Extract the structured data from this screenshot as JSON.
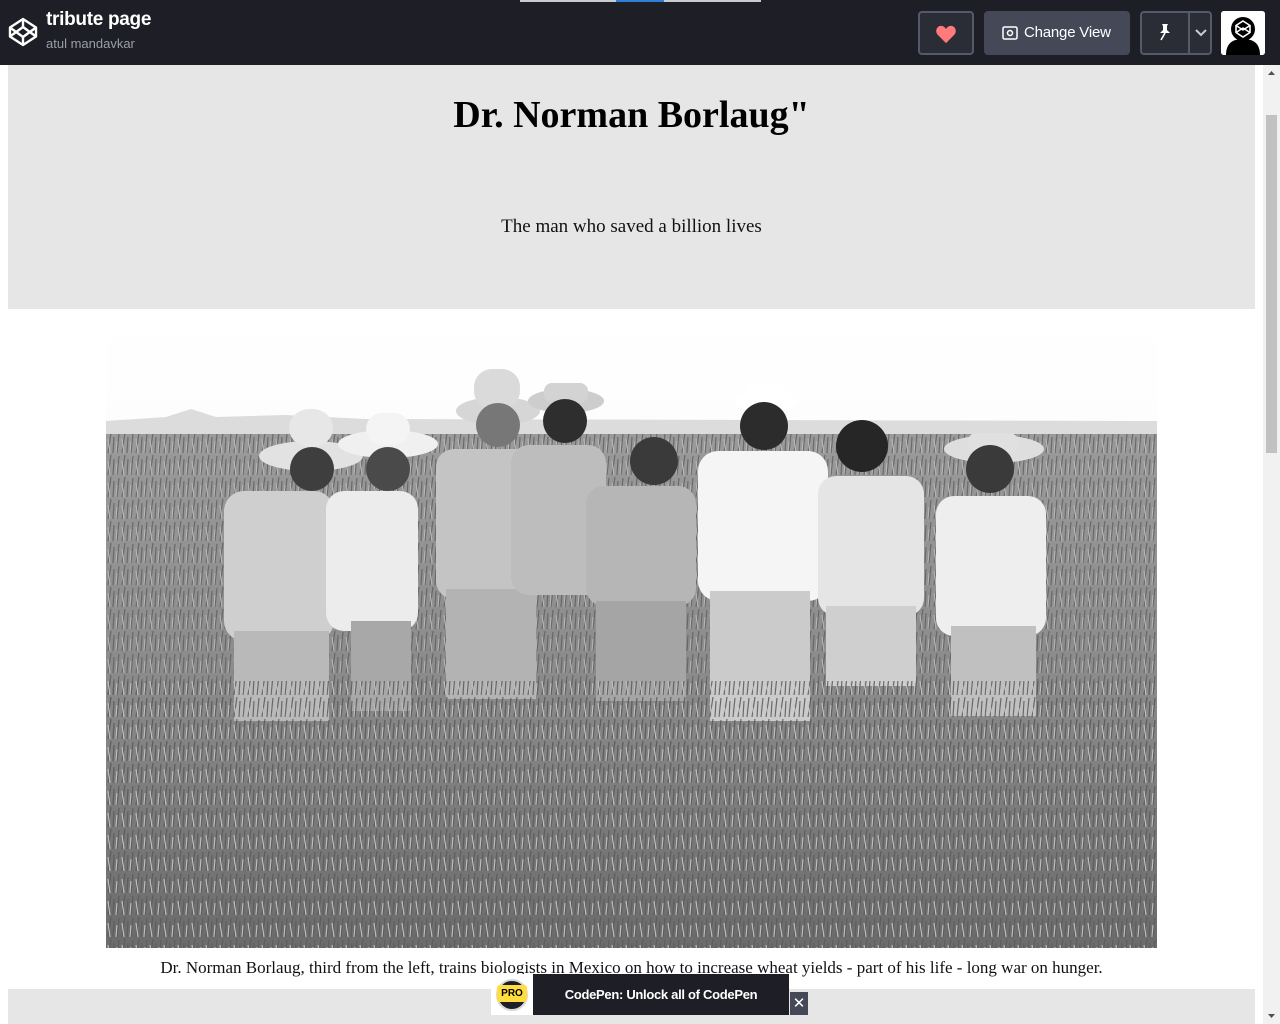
{
  "topbar": {
    "title": "tribute page",
    "author": "atul mandavkar",
    "change_view_label": "Change View"
  },
  "page": {
    "title": "Dr. Norman Borlaug\"",
    "subtitle": "The man who saved a billion lives",
    "caption": "Dr. Norman Borlaug, third from the left, trains biologists in Mexico on how to increase wheat yields - part of his life - long war on hunger."
  },
  "promo": {
    "badge": "PRO",
    "text": "CodePen: Unlock all of CodePen",
    "close": "✕"
  },
  "colors": {
    "topbar_bg": "#1e1f26",
    "button_bg": "#444857",
    "heart": "#ff7a7a",
    "header_bg": "#e6e6e6",
    "pro_yellow": "#ffdd40"
  },
  "icons": [
    "codepen-logo-icon",
    "heart-icon",
    "change-view-icon",
    "pin-icon",
    "chevron-down-icon",
    "avatar-icon",
    "close-icon"
  ]
}
